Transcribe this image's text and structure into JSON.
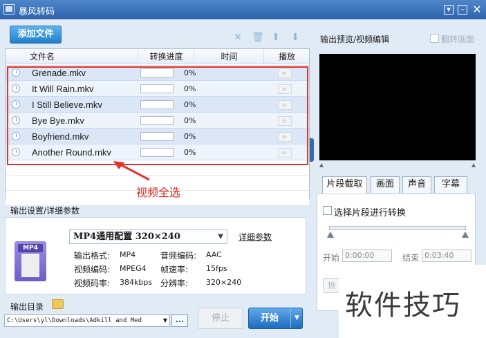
{
  "window": {
    "title": "暴风转码"
  },
  "toolbar": {
    "add_file": "添加文件"
  },
  "list": {
    "headers": {
      "name": "文件名",
      "progress": "转换进度",
      "time": "时间",
      "play": "播放"
    },
    "rows": [
      {
        "name": "Grenade.mkv",
        "progress": "0%"
      },
      {
        "name": "It Will Rain.mkv",
        "progress": "0%"
      },
      {
        "name": "I Still Believe.mkv",
        "progress": "0%"
      },
      {
        "name": "Bye Bye.mkv",
        "progress": "0%"
      },
      {
        "name": "Boyfriend.mkv",
        "progress": "0%"
      },
      {
        "name": "Another Round.mkv",
        "progress": "0%"
      }
    ]
  },
  "annotation": {
    "label": "视频全选",
    "color": "#e7322a"
  },
  "output_settings": {
    "section_label": "输出设置/详细参数",
    "file_badge": "MP4",
    "profile": "MP4通用配置  320×240",
    "detail_link": "详细参数",
    "params": {
      "format_label": "输出格式:",
      "format_value": "MP4",
      "audio_codec_label": "音频编码:",
      "audio_codec_value": "AAC",
      "video_codec_label": "视频编码:",
      "video_codec_value": "MPEG4",
      "framerate_label": "帧速率:",
      "framerate_value": "15fps",
      "bitrate_label": "视频码率:",
      "bitrate_value": "384kbps",
      "resolution_label": "分辨率:",
      "resolution_value": "320×240"
    }
  },
  "output_dir": {
    "label": "输出目录",
    "path": "C:\\Users\\yl\\Downloads\\Adkill and Med",
    "browse": "..."
  },
  "actions": {
    "stop": "停止",
    "start": "开始"
  },
  "preview": {
    "label": "输出预览/视频编辑",
    "flip_label": "翻转画面",
    "tabs": [
      "片段截取",
      "画面",
      "声音",
      "字幕"
    ],
    "clip_checkbox": "选择片段进行转换",
    "start_label": "开始",
    "start_time": "0:00:00",
    "end_label": "结束",
    "end_time": "0:03:40",
    "reset_label": "恢"
  },
  "watermark": {
    "text": "软件技巧"
  },
  "colors": {
    "titlebar": "#3a72bd",
    "accent": "#1f7fcb",
    "background": "#e1ebf6"
  }
}
